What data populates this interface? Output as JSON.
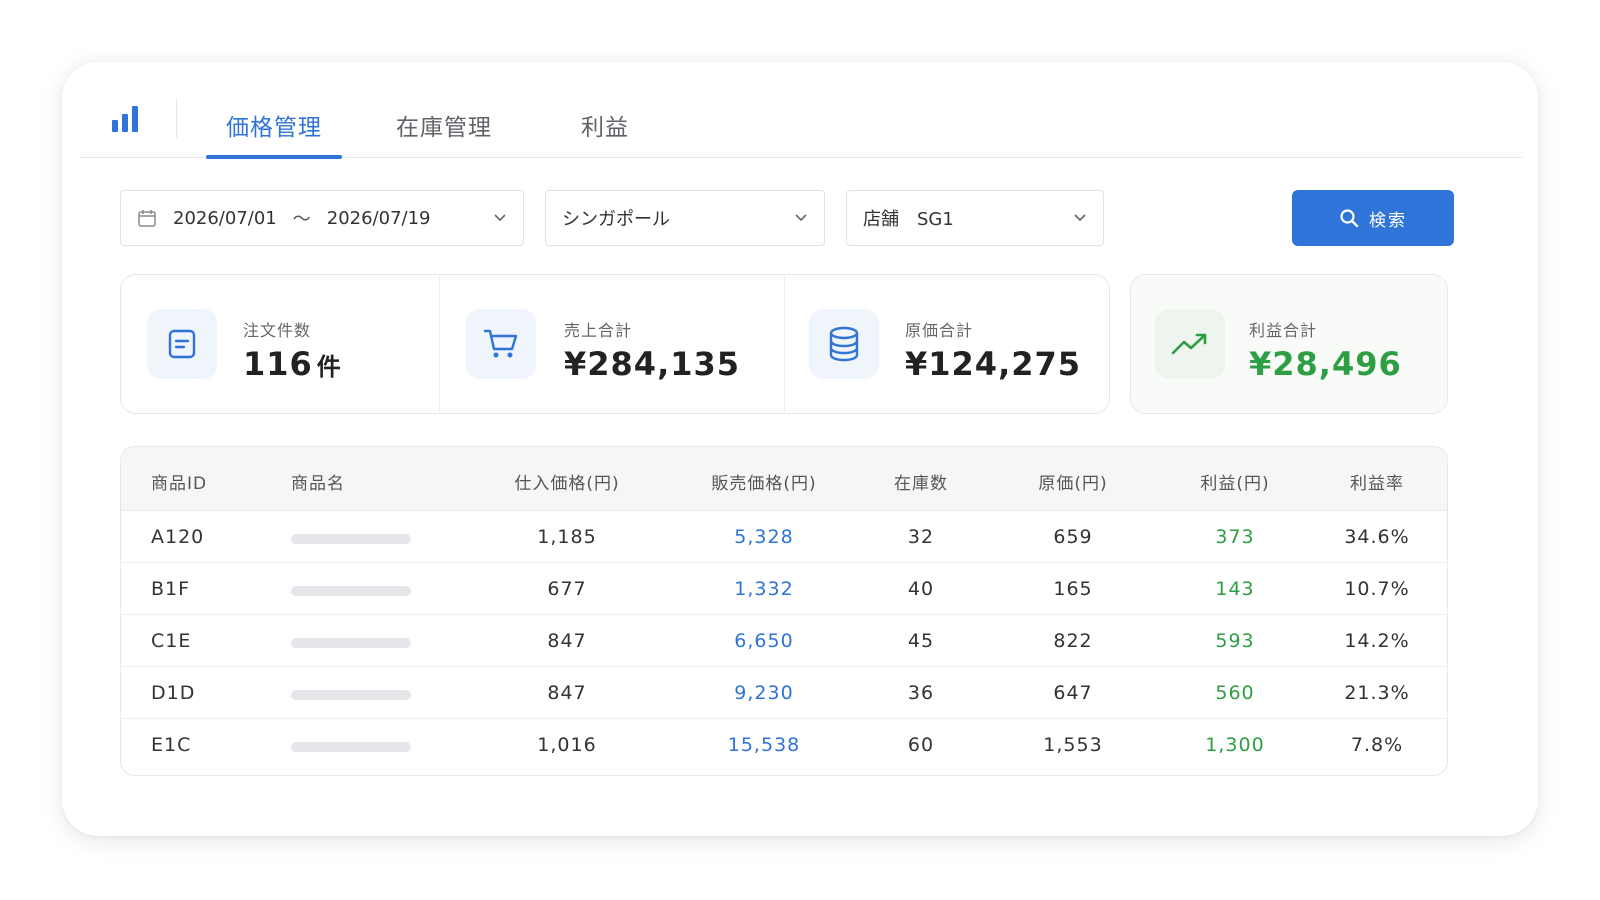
{
  "tabs": [
    {
      "label": "価格管理",
      "active": true
    },
    {
      "label": "在庫管理",
      "active": false
    },
    {
      "label": "利益",
      "active": false
    }
  ],
  "filters": {
    "date_start": "2026/07/01",
    "date_sep": "〜",
    "date_end": "2026/07/19",
    "country": "シンガポール",
    "store": "店舗　SG1",
    "search_label": "検索"
  },
  "stats": {
    "orders": {
      "label": "注文件数",
      "value": "116",
      "unit": "件"
    },
    "sales": {
      "label": "売上合計",
      "value": "¥284,135"
    },
    "cost": {
      "label": "原価合計",
      "value": "¥124,275"
    },
    "profit": {
      "label": "利益合計",
      "value": "¥28,496"
    }
  },
  "table": {
    "headers": {
      "id": "商品ID",
      "name": "商品名",
      "purchase": "仕入価格(円)",
      "sale": "販売価格(円)",
      "stock": "在庫数",
      "cost": "原価(円)",
      "profit": "利益(円)",
      "rate": "利益率"
    },
    "rows": [
      {
        "id": "A120",
        "purchase": "1,185",
        "sale": "5,328",
        "stock": "32",
        "cost": "659",
        "profit": "373",
        "rate": "34.6%"
      },
      {
        "id": "B1F",
        "purchase": "677",
        "sale": "1,332",
        "stock": "40",
        "cost": "165",
        "profit": "143",
        "rate": "10.7%"
      },
      {
        "id": "C1E",
        "purchase": "847",
        "sale": "6,650",
        "stock": "45",
        "cost": "822",
        "profit": "593",
        "rate": "14.2%"
      },
      {
        "id": "D1D",
        "purchase": "847",
        "sale": "9,230",
        "stock": "36",
        "cost": "647",
        "profit": "560",
        "rate": "21.3%"
      },
      {
        "id": "E1C",
        "purchase": "1,016",
        "sale": "15,538",
        "stock": "60",
        "cost": "1,553",
        "profit": "1,300",
        "rate": "7.8%"
      }
    ]
  },
  "colors": {
    "accent": "#2f74d8",
    "profit": "#2e9e44"
  }
}
